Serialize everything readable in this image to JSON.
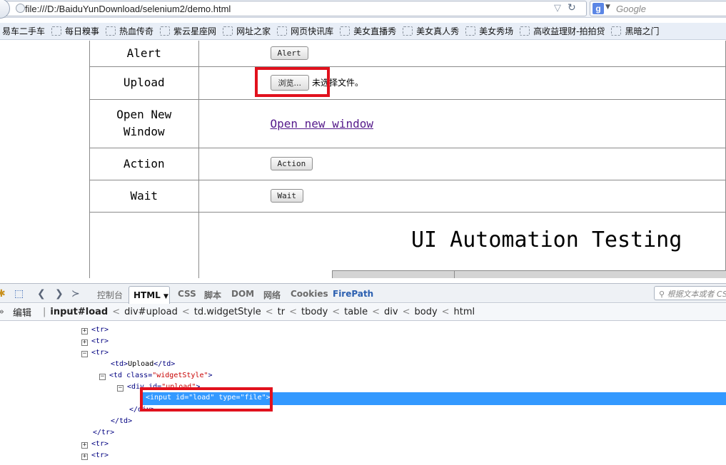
{
  "browser": {
    "url": "file:///D:/BaiduYunDownload/selenium2/demo.html",
    "search_placeholder": "Google",
    "search_engine_letter": "g",
    "bookmarks": [
      "易车二手车",
      "每日糗事",
      "热血传奇",
      "紫云星座网",
      "网址之家",
      "网页快讯库",
      "美女直播秀",
      "美女真人秀",
      "美女秀场",
      "高收益理财-拍拍贷",
      "黑暗之门"
    ]
  },
  "page": {
    "rows": {
      "alert": {
        "label": "Alert",
        "button": "Alert"
      },
      "upload": {
        "label": "Upload",
        "browse_button": "浏览...",
        "file_status": "未选择文件。"
      },
      "open_new_window": {
        "label_line1": "Open New",
        "label_line2": "Window",
        "link": "Open new window"
      },
      "action": {
        "label": "Action",
        "button": "Action"
      },
      "wait": {
        "label": "Wait",
        "button": "Wait"
      }
    },
    "heading": "UI Automation Testing"
  },
  "firebug": {
    "tabs": {
      "console": "控制台",
      "html": "HTML",
      "css": "CSS",
      "script": "脚本",
      "dom": "DOM",
      "net": "网络",
      "cookies": "Cookies",
      "firepath": "FirePath"
    },
    "search_placeholder": "根据文本或者 CSS",
    "edit_label": "编辑",
    "breadcrumb": [
      "input#load",
      "div#upload",
      "td.widgetStyle",
      "tr",
      "tbody",
      "table",
      "div",
      "body",
      "html"
    ],
    "tree": {
      "tr": "<tr>",
      "tr_close": "</tr>",
      "td_open": "<td>",
      "td_close": "</td>",
      "td_upload_text": "Upload",
      "td_widget_open": "<td",
      "class_attr": "class=",
      "class_val": "\"widgetStyle\"",
      "div_open": "<div",
      "id_attr": "id=",
      "div_id_val": "\"upload\"",
      "input_open": "<input",
      "input_id_val": "\"load\"",
      "type_attr": "type=",
      "type_val": "\"file\"",
      "div_close": "</div>",
      "gt": ">"
    }
  },
  "colors": {
    "highlight": "#e1111d",
    "selection": "#3399ff",
    "visited_link": "#551a8b"
  }
}
